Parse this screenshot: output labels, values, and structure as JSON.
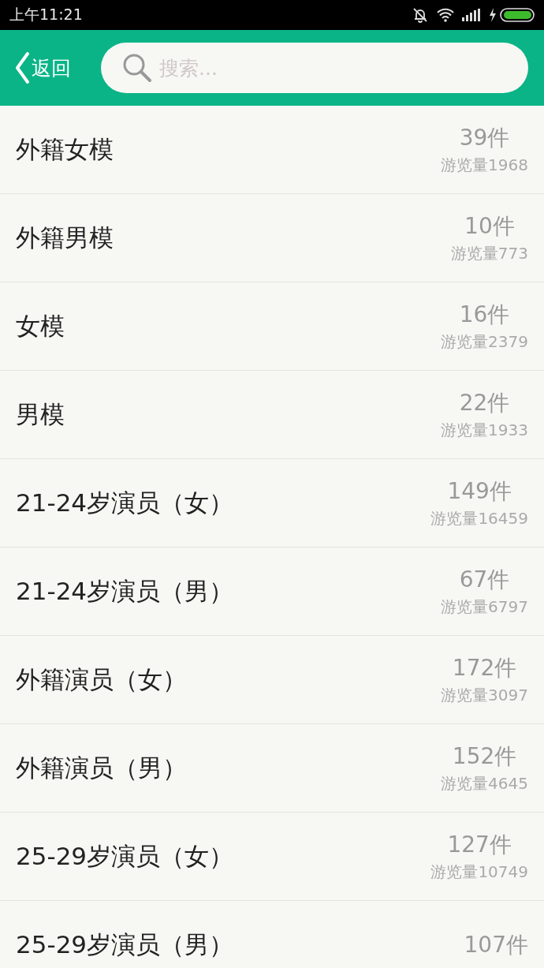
{
  "status_bar": {
    "time": "上午11:21"
  },
  "header": {
    "back_label": "返回",
    "search": {
      "placeholder": "搜索..."
    }
  },
  "categories": [
    {
      "name": "外籍女模",
      "count": "39件",
      "views": "游览量1968"
    },
    {
      "name": "外籍男模",
      "count": "10件",
      "views": "游览量773"
    },
    {
      "name": "女模",
      "count": "16件",
      "views": "游览量2379"
    },
    {
      "name": "男模",
      "count": "22件",
      "views": "游览量1933"
    },
    {
      "name": "21-24岁演员（女）",
      "count": "149件",
      "views": "游览量16459"
    },
    {
      "name": "21-24岁演员（男）",
      "count": "67件",
      "views": "游览量6797"
    },
    {
      "name": "外籍演员（女）",
      "count": "172件",
      "views": "游览量3097"
    },
    {
      "name": "外籍演员（男）",
      "count": "152件",
      "views": "游览量4645"
    },
    {
      "name": "25-29岁演员（女）",
      "count": "127件",
      "views": "游览量10749"
    },
    {
      "name": "25-29岁演员（男）",
      "count": "107件"
    }
  ]
}
